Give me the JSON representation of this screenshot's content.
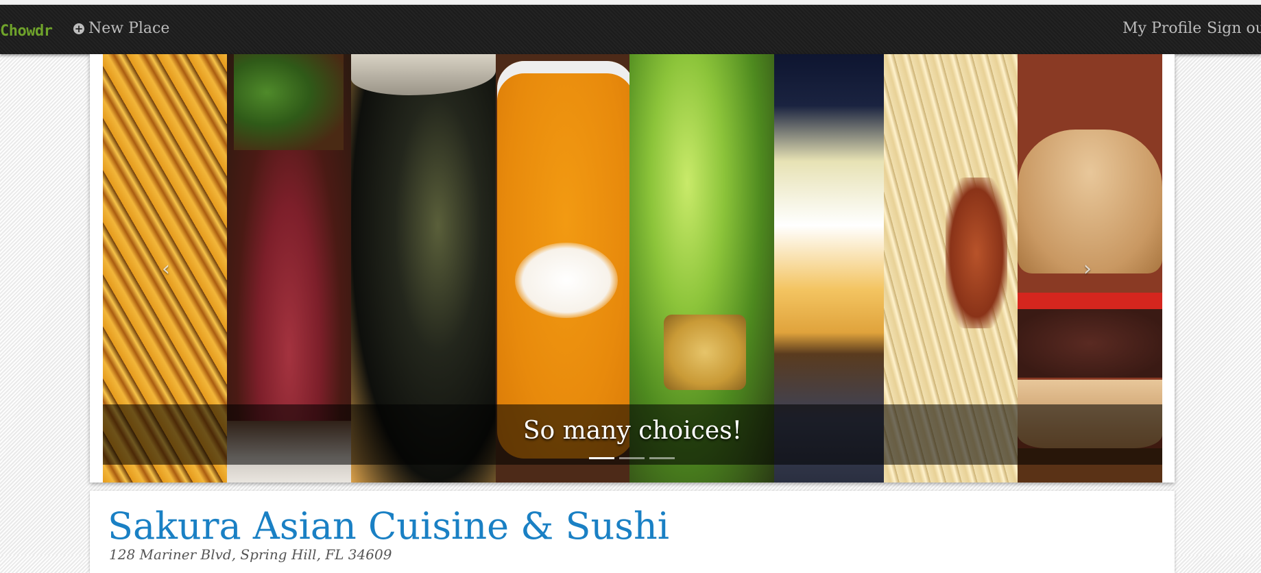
{
  "navbar": {
    "brand": "Chowdr",
    "new_place_label": "New Place",
    "my_profile_label": "My Profile",
    "sign_out_label": "Sign out"
  },
  "carousel": {
    "caption": "So many choices!",
    "indicator_count": 3,
    "active_indicator": 0,
    "prev_icon": "‹",
    "next_icon": "›",
    "images": [
      "fries",
      "steak",
      "mussels",
      "soup",
      "salad",
      "pie",
      "pasta",
      "burger"
    ]
  },
  "place": {
    "name": "Sakura Asian Cuisine & Sushi",
    "address": "128 Mariner Blvd, Spring Hill, FL 34609"
  },
  "colors": {
    "brand": "#6fa32b",
    "title": "#1a80c4",
    "navbar_bg": "#222222"
  }
}
